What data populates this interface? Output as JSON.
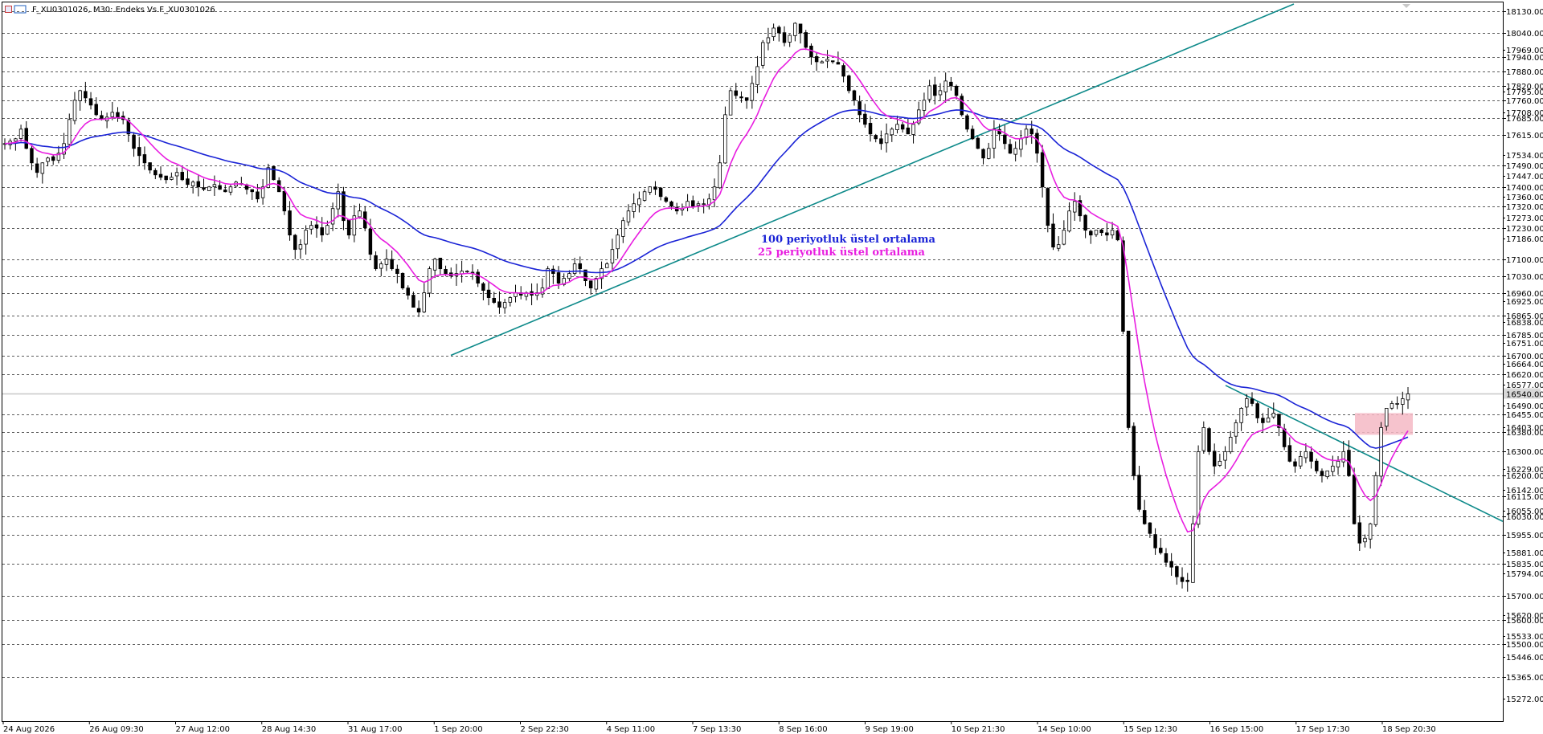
{
  "window": {
    "title": "F_XU0301026, M30:  Endeks Vs F_XU0301026"
  },
  "annotations": {
    "ema100_label": "100 periyotluk üstel ortalama",
    "ema25_label": "25 periyotluk üstel ortalama"
  },
  "colors": {
    "candle": "#000000",
    "ema100": "#1a23d6",
    "ema25": "#e81ee0",
    "trendline": "#0e8a8a",
    "support_box": "#f4b8c4",
    "grid": "#000000",
    "current_price_line": "#c8c8c8"
  },
  "chart_data": {
    "type": "candlestick",
    "symbol": "F_XU0301026",
    "timeframe": "M30",
    "ylim": [
      15180,
      18160
    ],
    "price_levels": [
      18130,
      18040,
      17940,
      17880,
      17820,
      17760,
      17685,
      17615,
      17490,
      17400,
      17320,
      17230,
      17100,
      17030,
      16960,
      16865,
      16785,
      16700,
      16620,
      16455,
      16380,
      16300,
      16200,
      16115,
      16030,
      15955,
      15835,
      15700,
      15600,
      15500,
      15365
    ],
    "minor_ticks": [
      "17969.00",
      "17795.00",
      "17708.00",
      "17534.00",
      "17447.00",
      "17360.00",
      "17273.00",
      "17186.00",
      "16925.00",
      "16838.00",
      "16751.00",
      "16664.00",
      "16577.00",
      "16490.00",
      "16403.00",
      "16229.00",
      "16142.00",
      "16055.00",
      "15881.00",
      "15794.00",
      "15620.00",
      "15533.00",
      "15446.00",
      "15272.00"
    ],
    "current_price": 16540,
    "x_tick_labels": [
      "24 Aug 2026",
      "26 Aug 09:30",
      "27 Aug 12:00",
      "28 Aug 14:30",
      "31 Aug 17:00",
      "1 Sep 20:00",
      "2 Sep 22:30",
      "4 Sep 11:00",
      "7 Sep 13:30",
      "8 Sep 16:00",
      "9 Sep 19:00",
      "10 Sep 21:30",
      "14 Sep 10:00",
      "15 Sep 12:30",
      "16 Sep 15:00",
      "17 Sep 17:30",
      "18 Sep 20:30"
    ],
    "closes": [
      17580,
      17590,
      17600,
      17640,
      17560,
      17500,
      17460,
      17500,
      17520,
      17510,
      17540,
      17580,
      17680,
      17760,
      17800,
      17770,
      17740,
      17700,
      17680,
      17690,
      17710,
      17690,
      17680,
      17620,
      17560,
      17530,
      17500,
      17470,
      17450,
      17440,
      17430,
      17440,
      17460,
      17430,
      17410,
      17420,
      17400,
      17390,
      17400,
      17410,
      17390,
      17380,
      17400,
      17420,
      17410,
      17390,
      17380,
      17350,
      17400,
      17480,
      17430,
      17380,
      17300,
      17200,
      17140,
      17160,
      17220,
      17240,
      17230,
      17200,
      17240,
      17310,
      17380,
      17260,
      17200,
      17280,
      17300,
      17230,
      17120,
      17060,
      17080,
      17100,
      17060,
      17040,
      16980,
      16950,
      16900,
      16880,
      16960,
      17060,
      17100,
      17060,
      17040,
      17030,
      17040,
      17050,
      17050,
      17040,
      17000,
      16970,
      16940,
      16920,
      16900,
      16920,
      16940,
      16960,
      16950,
      16960,
      16950,
      16960,
      16980,
      17060,
      17040,
      17000,
      17020,
      17040,
      17080,
      17060,
      17010,
      16980,
      17020,
      17060,
      17080,
      17140,
      17200,
      17260,
      17300,
      17330,
      17350,
      17380,
      17400,
      17390,
      17360,
      17340,
      17320,
      17300,
      17310,
      17340,
      17320,
      17330,
      17330,
      17350,
      17400,
      17500,
      17700,
      17800,
      17780,
      17770,
      17760,
      17830,
      17900,
      18000,
      18020,
      18060,
      18040,
      18000,
      18030,
      18080,
      18040,
      17980,
      17940,
      17920,
      17920,
      17930,
      17920,
      17910,
      17860,
      17800,
      17760,
      17700,
      17660,
      17620,
      17600,
      17580,
      17620,
      17640,
      17660,
      17640,
      17620,
      17660,
      17720,
      17760,
      17820,
      17780,
      17800,
      17840,
      17820,
      17780,
      17700,
      17640,
      17600,
      17560,
      17520,
      17560,
      17640,
      17620,
      17580,
      17540,
      17560,
      17600,
      17640,
      17620,
      17540,
      17400,
      17240,
      17150,
      17160,
      17220,
      17300,
      17340,
      17280,
      17220,
      17200,
      17220,
      17210,
      17200,
      17220,
      17180,
      16800,
      16400,
      16200,
      16060,
      16000,
      15960,
      15900,
      15880,
      15840,
      15820,
      15780,
      15760,
      15760,
      16000,
      16300,
      16400,
      16300,
      16240,
      16260,
      16300,
      16360,
      16420,
      16480,
      16520,
      16500,
      16440,
      16420,
      16440,
      16460,
      16400,
      16320,
      16260,
      16240,
      16280,
      16300,
      16260,
      16220,
      16200,
      16220,
      16240,
      16260,
      16300,
      16200,
      16000,
      15920,
      15940,
      16000,
      16200,
      16400,
      16480,
      16500,
      16500,
      16520,
      16540
    ]
  }
}
